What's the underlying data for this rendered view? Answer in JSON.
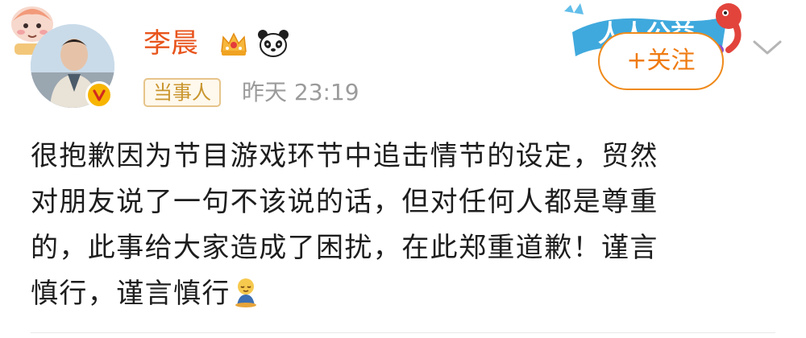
{
  "user": {
    "name": "李晨",
    "role_tag": "当事人",
    "time": "昨天 23:19",
    "badges": [
      "crown-icon",
      "panda-icon"
    ],
    "verified": true
  },
  "follow_button": {
    "label": "+关注"
  },
  "banner": {
    "text": "人人公益"
  },
  "post": {
    "lines": [
      "很抱歉因为节目游戏环节中追击情节的设定，贸然",
      "对朋友说了一句不该说的话，但对任何人都是尊重",
      "的，此事给大家造成了困扰，在此郑重道歉！谨言",
      "慎行，谨言慎行"
    ],
    "trailing_emoji": "bowing-emoji-icon"
  },
  "colors": {
    "username": "#e8541c",
    "follow_accent": "#ef7b12",
    "role_tag_text": "#c9952d",
    "time_text": "#9b9b9b",
    "body_text": "#1d1d1d",
    "verify_badge": "#f7b500"
  }
}
